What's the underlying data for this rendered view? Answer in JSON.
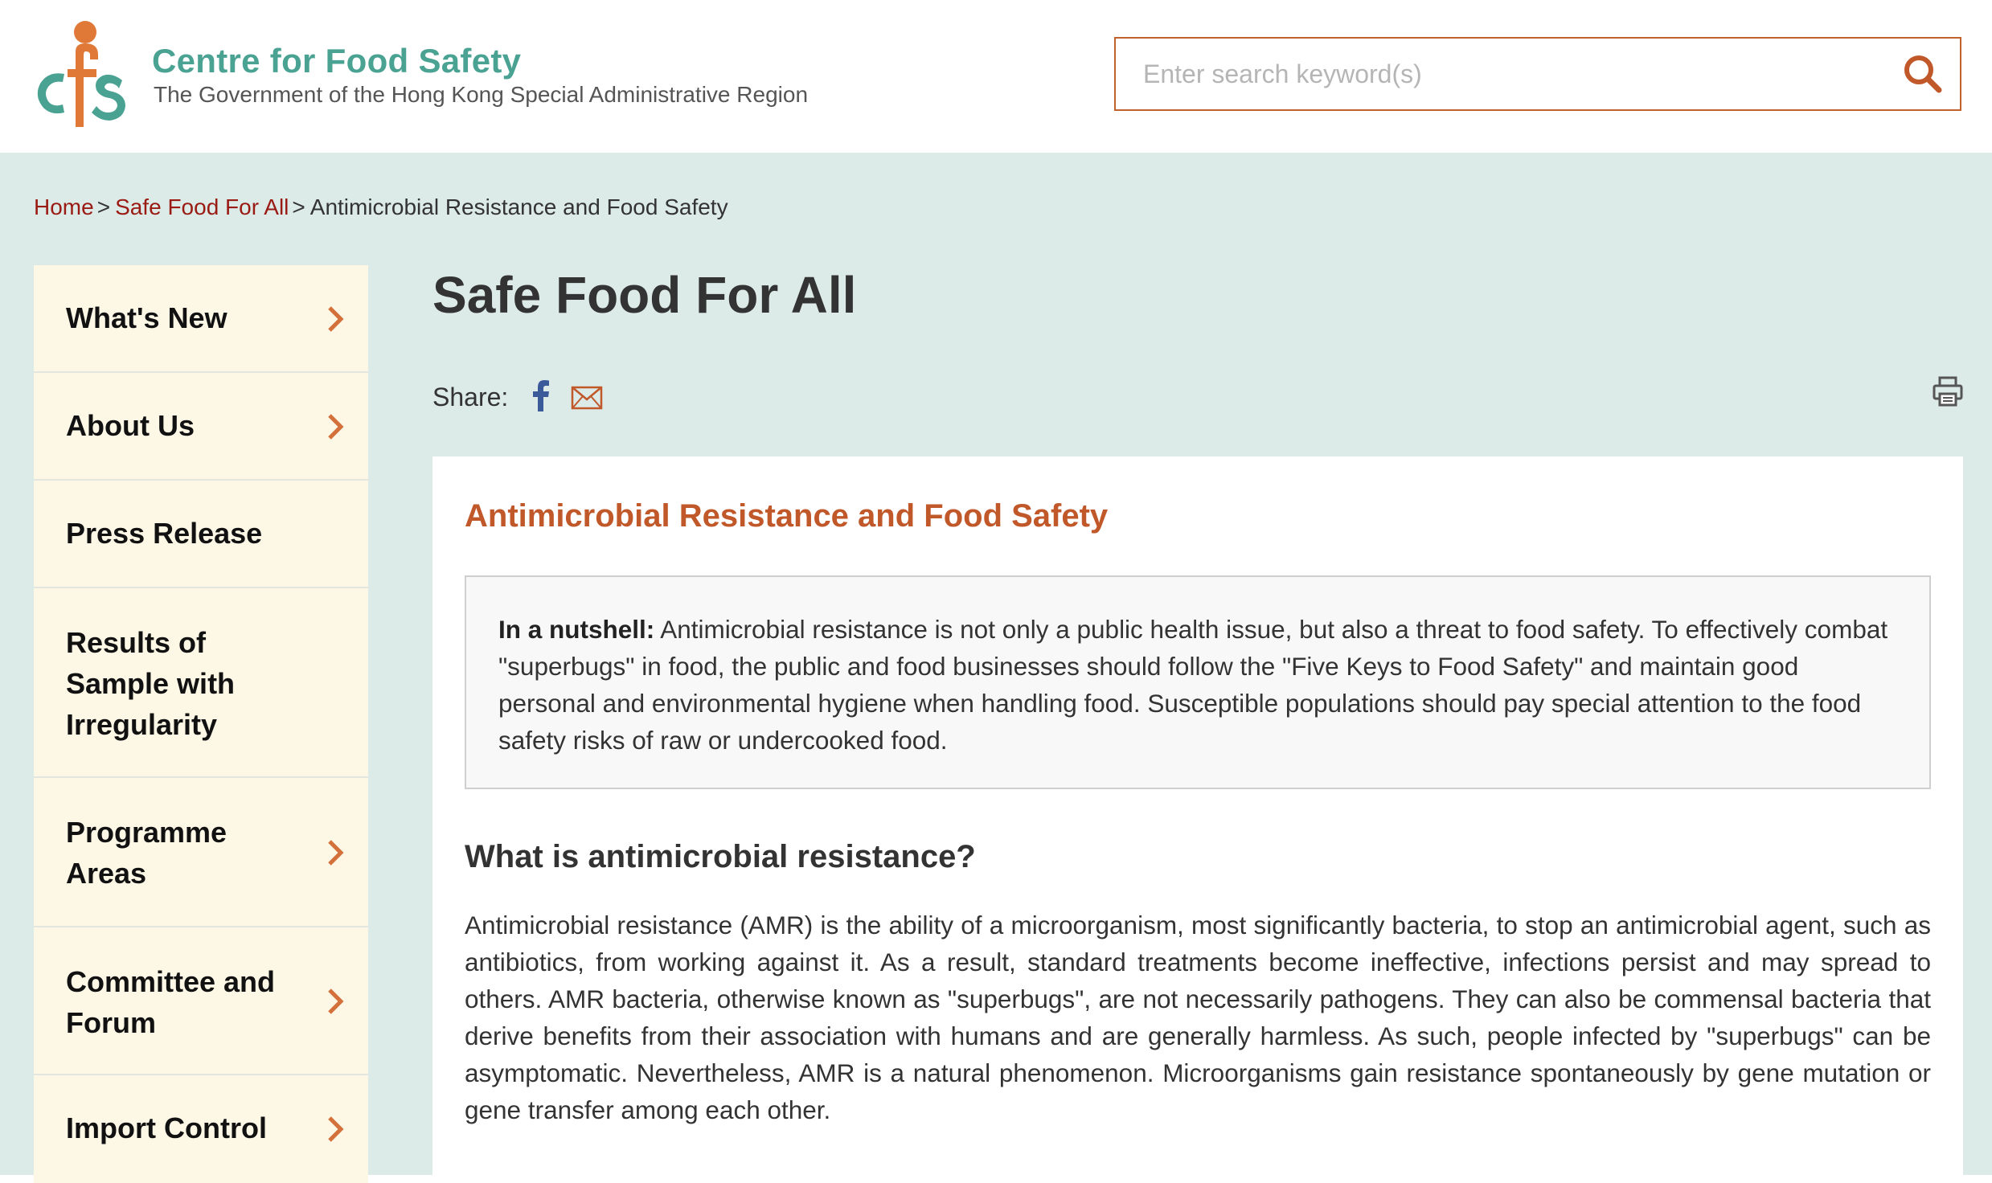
{
  "header": {
    "site_name": "Centre for Food Safety",
    "site_subtitle": "The Government of the Hong Kong Special Administrative Region",
    "search_placeholder": "Enter search keyword(s)"
  },
  "breadcrumb": {
    "items": [
      "Home",
      "Safe Food For All"
    ],
    "separator": ">",
    "current": "Antimicrobial Resistance and Food Safety"
  },
  "sidebar": {
    "items": [
      {
        "label": "What's New",
        "has_arrow": true
      },
      {
        "label": "About Us",
        "has_arrow": true
      },
      {
        "label": "Press Release",
        "has_arrow": false
      },
      {
        "label": "Results of Sample with Irregularity",
        "has_arrow": false
      },
      {
        "label": "Programme Areas",
        "has_arrow": true
      },
      {
        "label": "Committee and Forum",
        "has_arrow": true
      },
      {
        "label": "Import Control",
        "has_arrow": true
      }
    ]
  },
  "main": {
    "page_title": "Safe Food For All",
    "share_label": "Share:",
    "article": {
      "title": "Antimicrobial Resistance and Food Safety",
      "nutshell_label": "In a nutshell:",
      "nutshell_text": " Antimicrobial resistance is not only a public health issue, but also a threat to food safety. To effectively combat \"superbugs\" in food, the public and food businesses should follow the \"Five Keys to Food Safety\" and maintain good personal and environmental hygiene when handling food. Susceptible populations should pay special attention to the food safety risks of raw or undercooked food.",
      "section_heading": "What is antimicrobial resistance?",
      "paragraph": "Antimicrobial resistance (AMR) is the ability of a microorganism, most significantly bacteria, to stop an antimicrobial agent, such as antibiotics, from working against it. As a result, standard treatments become ineffective, infections persist and may spread to others. AMR bacteria, otherwise known as \"superbugs\", are not necessarily pathogens. They can also be commensal bacteria that derive benefits from their association with humans and are generally harmless. As such, people infected by \"superbugs\" can be asymptomatic. Nevertheless, AMR is a natural phenomenon. Microorganisms gain resistance spontaneously by gene mutation or gene transfer among each other."
    }
  },
  "icons": {
    "logo": "cfs-logo-icon",
    "search": "search-icon",
    "chevron": "chevron-right-icon",
    "facebook": "facebook-icon",
    "email": "email-icon",
    "print": "print-icon"
  },
  "colors": {
    "brand_teal": "#4aa293",
    "accent_orange": "#c0582a",
    "link_red": "#9a1b14",
    "background_mint": "#dceae8",
    "sidebar_cream": "#fdf7e6"
  }
}
